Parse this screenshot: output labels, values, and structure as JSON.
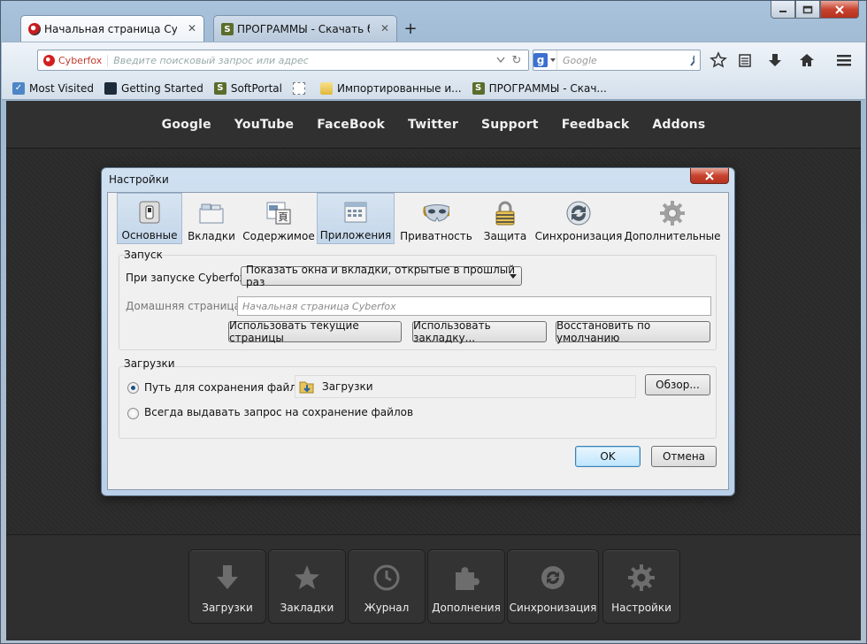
{
  "window": {
    "tabs": [
      {
        "title": "Начальная страница Cyb...",
        "active": true
      },
      {
        "title": "ПРОГРАММЫ - Скачать б...",
        "active": false
      }
    ]
  },
  "navbar": {
    "site_label": "Cyberfox",
    "url_placeholder": "Введите поисковый запрос или адрес",
    "search_engine": "g",
    "search_placeholder": "Google"
  },
  "bookmarks": [
    {
      "label": "Most Visited",
      "icon": "most-visited-icon"
    },
    {
      "label": "Getting Started",
      "icon": "getting-started-icon"
    },
    {
      "label": "SoftPortal",
      "icon": "softportal-icon"
    },
    {
      "label": "",
      "icon": "empty-bookmark-icon"
    },
    {
      "label": "Импортированные и...",
      "icon": "folder-icon"
    },
    {
      "label": "ПРОГРАММЫ - Скач...",
      "icon": "softportal-icon"
    }
  ],
  "page": {
    "toplinks": [
      "Google",
      "YouTube",
      "FaceBook",
      "Twitter",
      "Support",
      "Feedback",
      "Addons"
    ],
    "tiles": [
      {
        "label": "Загрузки",
        "icon": "download-arrow-icon"
      },
      {
        "label": "Закладки",
        "icon": "star-icon"
      },
      {
        "label": "Журнал",
        "icon": "clock-icon"
      },
      {
        "label": "Дополнения",
        "icon": "puzzle-icon"
      },
      {
        "label": "Синхронизация",
        "icon": "sync-icon"
      },
      {
        "label": "Настройки",
        "icon": "gear-icon"
      }
    ]
  },
  "dialog": {
    "title": "Настройки",
    "panes": [
      {
        "label": "Основные",
        "icon": "switch-icon",
        "selected": true
      },
      {
        "label": "Вкладки",
        "icon": "tabs-icon",
        "selected": false
      },
      {
        "label": "Содержимое",
        "icon": "content-icon",
        "selected": false
      },
      {
        "label": "Приложения",
        "icon": "applications-icon",
        "selected": true
      },
      {
        "label": "Приватность",
        "icon": "mask-icon",
        "selected": false
      },
      {
        "label": "Защита",
        "icon": "lock-icon",
        "selected": false
      },
      {
        "label": "Синхронизация",
        "icon": "sync-icon",
        "selected": false
      },
      {
        "label": "Дополнительные",
        "icon": "gear-icon",
        "selected": false
      }
    ],
    "startup": {
      "group_title": "Запуск",
      "on_start_label": "При запуске Cyberfox:",
      "on_start_value": "Показать окна и вкладки, открытые в прошлый раз",
      "homepage_label": "Домашняя страница:",
      "homepage_placeholder": "Начальная страница Cyberfox",
      "btn_use_current": "Использовать текущие страницы",
      "btn_use_bookmark": "Использовать закладку...",
      "btn_restore_default": "Восстановить по умолчанию"
    },
    "downloads": {
      "group_title": "Загрузки",
      "save_path_label": "Путь для сохранения файлов",
      "save_path_value": "Загрузки",
      "browse_label": "Обзор...",
      "always_ask_label": "Всегда выдавать запрос на сохранение файлов",
      "save_path_selected": true
    },
    "ok_label": "OK",
    "cancel_label": "Отмена"
  }
}
